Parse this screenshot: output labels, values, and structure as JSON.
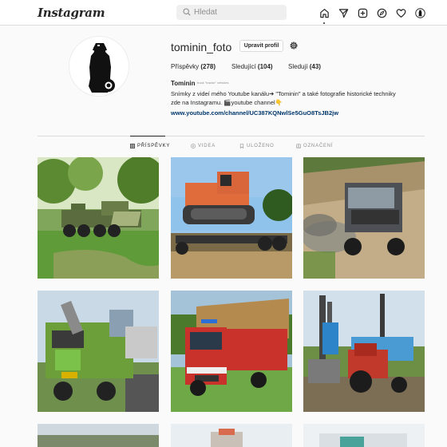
{
  "header": {
    "logo": "Instagram",
    "search_placeholder": "Hledat",
    "nav_icons": [
      "home-icon",
      "send-icon",
      "new-post-icon",
      "explore-icon",
      "heart-icon",
      "profile-avatar"
    ]
  },
  "profile": {
    "username": "tominin_foto",
    "edit_button": "Upravit profil",
    "stats": {
      "posts_label": "Příspěvky",
      "posts_count": "(278)",
      "following_label": "Sledující",
      "following_count": "(104)",
      "followers_label": "Sledují",
      "followers_count": "(43)"
    },
    "bio": {
      "name": "Tominin",
      "category": "truck \"tractor\" vehicles",
      "line1": "Snímky z videí mého Youtube kanálu➜ \"Tominin\" a také fotografie historické techniky",
      "line2": "zde na Instagramu. 🎬youtube channel👇",
      "link": "www.youtube.com/channel/UC387KQNwlSe5GuO8TsJB2jw"
    }
  },
  "tabs": [
    {
      "label": "PŘÍSPĚVKY",
      "active": true
    },
    {
      "label": "VIDEA",
      "active": false
    },
    {
      "label": "ULOŽENO",
      "active": false
    },
    {
      "label": "OZNAČENÍ",
      "active": false
    }
  ],
  "posts": [
    {
      "subject": "green military truck"
    },
    {
      "subject": "orange crawler tractor on trailer"
    },
    {
      "subject": "grey truck in dust"
    },
    {
      "subject": "green crane truck"
    },
    {
      "subject": "red fire truck"
    },
    {
      "subject": "red tractor with drilling rig"
    }
  ],
  "colors": {
    "link": "#00376b",
    "border": "#dbdbdb",
    "muted": "#8e8e8e",
    "text": "#262626"
  }
}
